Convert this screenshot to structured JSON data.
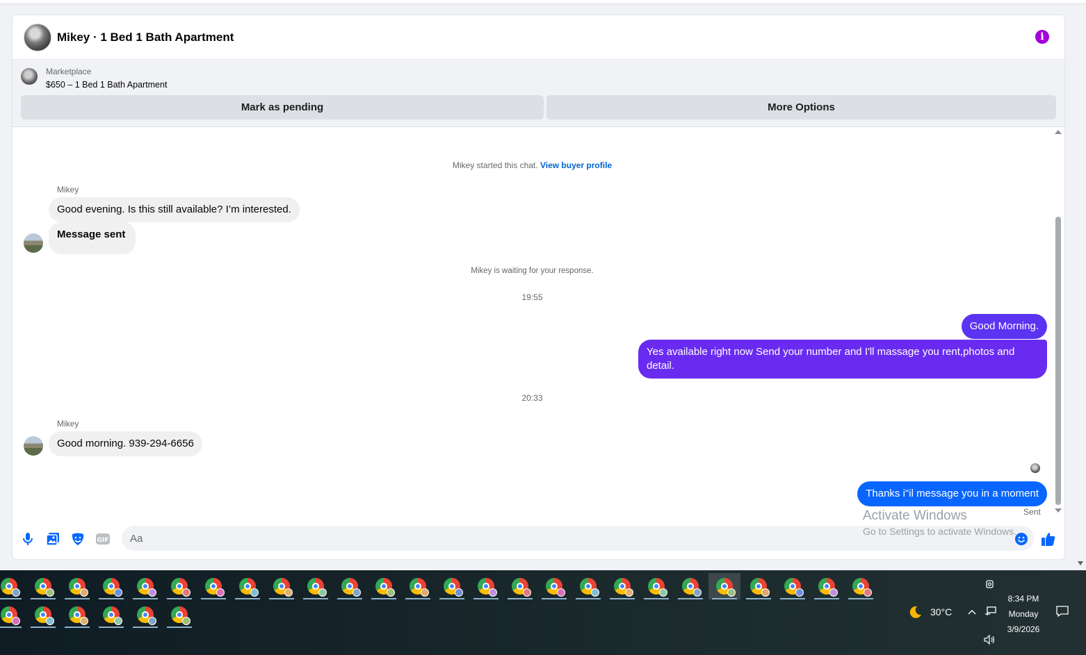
{
  "header": {
    "title": "Mikey · 1 Bed 1 Bath Apartment"
  },
  "listing": {
    "source": "Marketplace",
    "name": "$650 – 1 Bed 1 Bath Apartment",
    "mark_pending_label": "Mark as pending",
    "more_options_label": "More Options"
  },
  "messages": {
    "started_text": "Mikey started this chat.",
    "view_profile_link": "View buyer profile",
    "sender_name": "Mikey",
    "msg1": "Good evening. Is this still available? I’m interested.",
    "msg2": "Message sent",
    "waiting_text": "Mikey is waiting for your response.",
    "time1": "19:55",
    "out1": "Good Morning.",
    "out2": "Yes available right now Send your number and I'll massage you rent,photos and detail.",
    "time2": "20:33",
    "msg3": "Good morning. 939-294-6656",
    "out3": "Thanks i\"il message you in a moment",
    "sent_status": "Sent"
  },
  "composer": {
    "placeholder": "Aa"
  },
  "watermark": {
    "title": "Activate Windows",
    "subtitle": "Go to Settings to activate Windows."
  },
  "taskbar": {
    "temperature": "30°C",
    "time": "8:34 PM",
    "day": "Monday",
    "date": "3/9/2026"
  },
  "colors": {
    "accent_purple": "#a100d8",
    "bubble_purple": "#5b34f1",
    "bubble_violet": "#6a2bf0",
    "bubble_blue": "#0866ff",
    "composer_icon_blue": "#0866ff",
    "link_blue": "#0064d1"
  },
  "icons": {
    "info": "info-icon",
    "mic": "microphone-icon",
    "gallery": "image-gallery-icon",
    "sticker": "sticker-icon",
    "gif": "gif-icon",
    "emoji": "emoji-icon",
    "like": "thumbs-up-icon"
  }
}
